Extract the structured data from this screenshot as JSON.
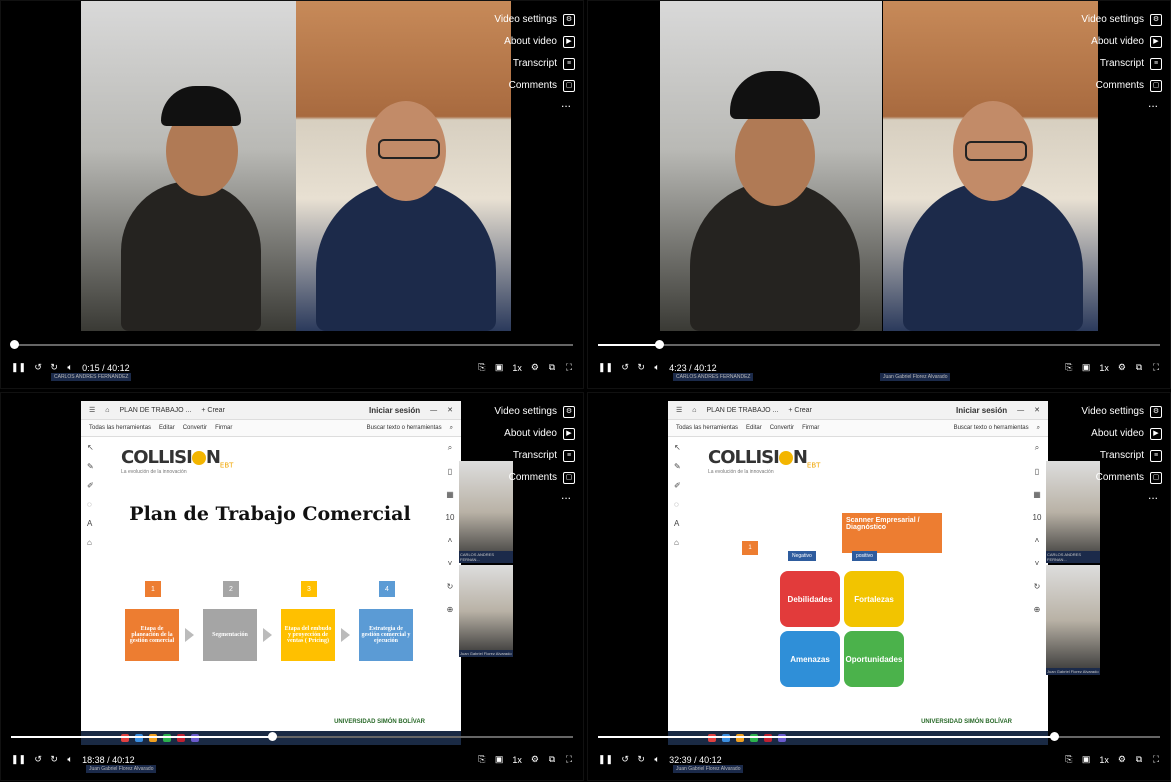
{
  "menu": {
    "video_settings": "Video settings",
    "about_video": "About video",
    "transcript": "Transcript",
    "comments": "Comments",
    "more": "..."
  },
  "players": [
    {
      "time": "0:15 / 40:12",
      "progress": 0.006,
      "name_left": "CARLOS ANDRES FERNANDEZ",
      "speed": "1x"
    },
    {
      "time": "4:23 / 40:12",
      "progress": 0.109,
      "name_left": "CARLOS ANDRES FERNANDEZ",
      "name_right": "Juan Gabriel Florez Alvarado",
      "speed": "1x"
    },
    {
      "time": "18:38 / 40:12",
      "progress": 0.464,
      "name_left": "Juan Gabriel Florez Alvarado",
      "speed": "1x"
    },
    {
      "time": "32:39 / 40:12",
      "progress": 0.812,
      "name_left": "Juan Gabriel Florez Alvarado",
      "speed": "1x"
    }
  ],
  "viewer": {
    "tab_title": "PLAN DE TRABAJO ...",
    "new_tab": "+ Crear",
    "sign_in": "Iniciar sesión",
    "menu_items": [
      "Todas las herramientas",
      "Editar",
      "Convertir",
      "Firmar"
    ],
    "search": "Buscar texto o herramientas"
  },
  "slide1": {
    "logo": "COLLISI",
    "logo_end": "N",
    "logo_sub": "EBT",
    "tagline": "La evolución de la innovación",
    "title": "Plan de Trabajo Comercial",
    "steps": [
      {
        "n": "1",
        "text": "Etapa de planeación de la gestión comercial",
        "color": "#ed7d31"
      },
      {
        "n": "2",
        "text": "Segmentación",
        "color": "#a5a5a5"
      },
      {
        "n": "3",
        "text": "Etapa del embudo y proyección de ventas ( Pricing)",
        "color": "#ffc000"
      },
      {
        "n": "4",
        "text": "Estrategia de gestión comercial y ejecución",
        "color": "#5b9bd5"
      }
    ],
    "university": "UNIVERSIDAD SIMÓN BOLÍVAR",
    "page_number": "10",
    "side_cam_label": "CARLOS ANDRES FERNAN..."
  },
  "slide2": {
    "scanner": "Scanner Empresarial / Diagnóstico",
    "negative": "Negativo",
    "positive": "positivo",
    "box_num": "1",
    "quadrants": [
      {
        "label": "Debilidades",
        "color": "#e23b3b"
      },
      {
        "label": "Fortalezas",
        "color": "#f2c400"
      },
      {
        "label": "Amenazas",
        "color": "#2f8fd8"
      },
      {
        "label": "Oportunidades",
        "color": "#4bb24b"
      }
    ],
    "university": "UNIVERSIDAD SIMÓN BOLÍVAR",
    "page_number": "10",
    "side_cam_label": "CARLOS ANDRES FERNAN..."
  }
}
